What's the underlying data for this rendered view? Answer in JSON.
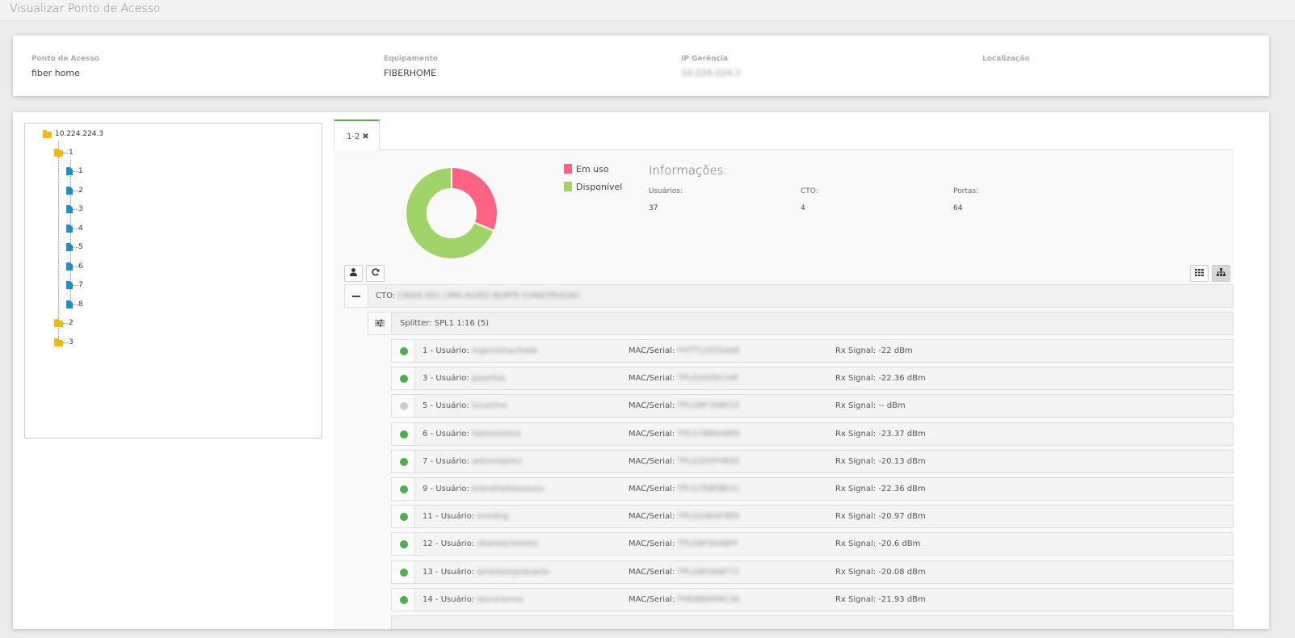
{
  "page": {
    "title": "Visualizar Ponto de Acesso"
  },
  "info": {
    "access_point_label": "Ponto de Acesso",
    "access_point_value": "fiber home",
    "equipment_label": "Equipamento",
    "equipment_value": "FIBERHOME",
    "ip_label": "IP Gerência",
    "ip_value": "10.224.224.3",
    "location_label": "Localização",
    "location_value": ""
  },
  "tree": {
    "root": "10.224.224.3",
    "node_1": "1",
    "children": [
      "1",
      "2",
      "3",
      "4",
      "5",
      "6",
      "7",
      "8"
    ],
    "node_2": "2",
    "node_3": "3"
  },
  "tab": {
    "label": "1-2",
    "close": "✖"
  },
  "colors": {
    "in_use": "#ff6384",
    "available": "#a0d468",
    "online": "#4cae4c",
    "offline": "#cccccc",
    "tab_accent": "#4cae4c"
  },
  "chart_data": {
    "type": "pie",
    "style": "doughnut",
    "categories": [
      "Em uso",
      "Disponível"
    ],
    "values": [
      5,
      11
    ],
    "legend": "right"
  },
  "stats": {
    "title": "Informações:",
    "users_label": "Usuários:",
    "users_value": "37",
    "cto_label": "CTO:",
    "cto_value": "4",
    "ports_label": "Portas:",
    "ports_value": "64"
  },
  "toolbar": {
    "user_icon": "user-icon",
    "refresh_icon": "refresh-icon",
    "grid_icon": "grid-icon",
    "tree_icon": "sitemap-icon"
  },
  "cto": {
    "prefix": "CTO:",
    "name": "CAIXA 001 LIMA ALVES NORTE CONSTRUCAO"
  },
  "splitter": {
    "label": "Splitter: SPL1 1:16 (5)"
  },
  "labels": {
    "user": "Usuário:",
    "mac": "MAC/Serial:",
    "rx": "Rx Signal:"
  },
  "rows": [
    {
      "num": "1",
      "user": "rogeriomachado",
      "mac": "FHTT11555A48",
      "rx": "-22 dBm",
      "status": "online"
    },
    {
      "num": "3",
      "user": "jpsantos",
      "mac": "TPLG2A58119F",
      "rx": "-22.36 dBm",
      "status": "online"
    },
    {
      "num": "5",
      "user": "lucasilva",
      "mac": "TPLG8F7A8E19",
      "rx": "-- dBm",
      "status": "offline"
    },
    {
      "num": "6",
      "user": "fabiosilveira",
      "mac": "TPLG7B80A6E9",
      "rx": "-23.37 dBm",
      "status": "online"
    },
    {
      "num": "7",
      "user": "antoniopires",
      "mac": "TPLG2D5F0E82",
      "rx": "-20.13 dBm",
      "status": "online"
    },
    {
      "num": "9",
      "user": "brenofreitassouza",
      "mac": "TPLG7E8FBE1C",
      "rx": "-22.36 dBm",
      "status": "online"
    },
    {
      "num": "11",
      "user": "mrodrig",
      "mac": "TPLG2AE0F9E9",
      "rx": "-20.97 dBm",
      "status": "online"
    },
    {
      "num": "12",
      "user": "elianascimento",
      "mac": "TPLG8F3A4BFF",
      "rx": "-20.6 dBm",
      "status": "online"
    },
    {
      "num": "13",
      "user": "ameliaregoduarte",
      "mac": "TPLG8F0A6F73",
      "rx": "-20.08 dBm",
      "status": "online"
    },
    {
      "num": "14",
      "user": "lauracorrea",
      "mac": "FHE8B65FAC3A",
      "rx": "-21.93 dBm",
      "status": "online"
    }
  ]
}
